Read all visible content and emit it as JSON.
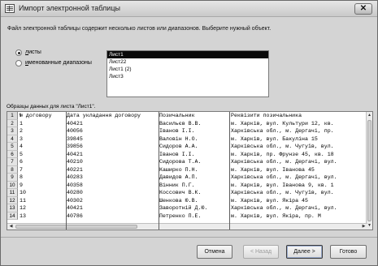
{
  "window": {
    "title": "Импорт электронной таблицы",
    "close_glyph": "✕"
  },
  "instruction": "Файл электронной таблицы содержит несколько листов или диапазонов.  Выберите нужный объект.",
  "options": {
    "sheets_label": "листы",
    "sheets_underlined_char": "л",
    "ranges_label": "именованные диапазоны",
    "ranges_underlined_char": "и",
    "selected": "sheets"
  },
  "sheet_list": {
    "items": [
      "Лист1",
      "Лист22",
      "Лист1 (2)",
      "Лист3"
    ],
    "selected_index": 0
  },
  "sample_caption": "Образцы данных для листа \"Лист1\".",
  "grid": {
    "header": [
      "№ договору",
      "Дата укладання договору",
      "Позичальник",
      "Реквізити позичальника"
    ],
    "rows": [
      [
        "1",
        "40421",
        "Васильєв В.В.",
        "м. Харків, вул. Культури 12, кв."
      ],
      [
        "2",
        "40056",
        "Іванов І.І.",
        "Харківська обл., м. Дергачі, пр."
      ],
      [
        "3",
        "39845",
        "Валовін Н.О.",
        "м. Харків, вул. Бакуліна 15"
      ],
      [
        "4",
        "39856",
        "Сидоров А.А.",
        "Харківська обл., м. Чугуїв, вул."
      ],
      [
        "5",
        "40421",
        "Іванов І.І.",
        "м. Харків, пр. Фрунзе 45, кв. 18"
      ],
      [
        "6",
        "40210",
        "Сидорова Т.А.",
        "Харківська обл., м. Дергачі, вул."
      ],
      [
        "7",
        "40221",
        "Каширко П.Н.",
        "м. Харків, вул. Іванова 45"
      ],
      [
        "8",
        "40283",
        "Давидов А.П.",
        "Харківська обл., м. Дергачі, вул."
      ],
      [
        "9",
        "40358",
        "Вінник П.Г.",
        "м. Харків, вул. Іванова 9, кв. 1"
      ],
      [
        "10",
        "40280",
        "Коссович В.К.",
        "Харківська обл., м. Чугуїв, вул."
      ],
      [
        "11",
        "40302",
        "Шенкова Ю.В.",
        "м. Харків, вул. Якіра 45"
      ],
      [
        "12",
        "40421",
        "Заворотній  Д.Ю.",
        "Харківська обл., м. Дергачі, вул."
      ],
      [
        "13",
        "40786",
        "Петренко П.Е.",
        "м. Харків, вул. Якіра, пр. М"
      ]
    ],
    "row_numbers": [
      "1",
      "2",
      "3",
      "4",
      "5",
      "6",
      "7",
      "8",
      "9",
      "10",
      "11",
      "12",
      "13",
      "14"
    ]
  },
  "buttons": {
    "cancel": "Отмена",
    "back": "< Назад",
    "next": "Далее >",
    "finish": "Готово"
  },
  "colors": {
    "selection": "#0a0a0a",
    "dialog_bg": "#d4d4d4"
  }
}
